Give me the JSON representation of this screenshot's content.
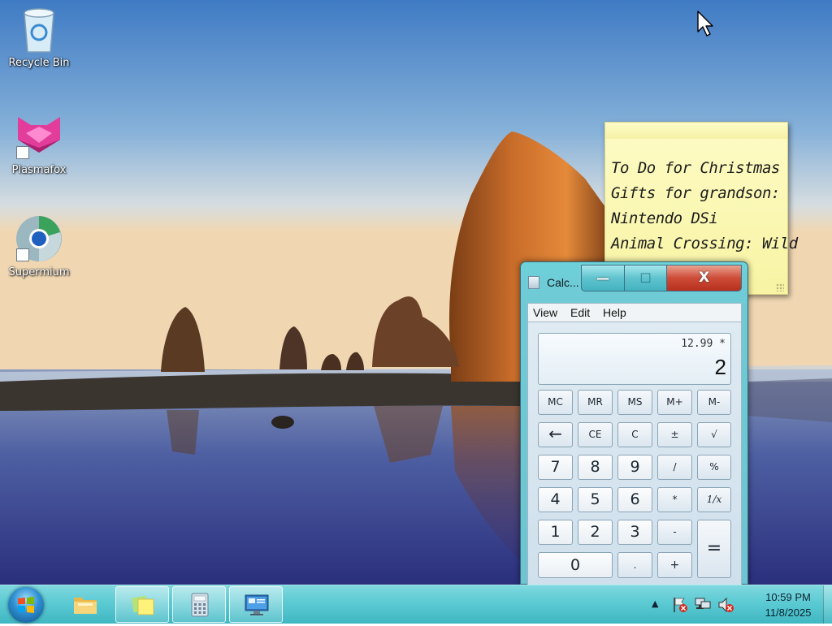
{
  "desktop": {
    "icons": [
      {
        "label": "Recycle Bin",
        "icon": "recycle-bin-icon"
      },
      {
        "label": "Plasmafox",
        "icon": "plasmafox-icon"
      },
      {
        "label": "Supermium",
        "icon": "supermium-icon"
      }
    ]
  },
  "sticky_note": {
    "lines": [
      "To Do for Christmas",
      "Gifts for grandson:",
      "Nintendo DSi",
      "Animal Crossing: Wild"
    ]
  },
  "calculator": {
    "title": "Calc...",
    "menu": [
      "View",
      "Edit",
      "Help"
    ],
    "expression": "12.99 *",
    "value": "2",
    "keys": {
      "mc": "MC",
      "mr": "MR",
      "ms": "MS",
      "mplus": "M+",
      "mminus": "M-",
      "back": "←",
      "ce": "CE",
      "c": "C",
      "plusminus": "±",
      "sqrt": "√",
      "k7": "7",
      "k8": "8",
      "k9": "9",
      "div": "/",
      "pct": "%",
      "k4": "4",
      "k5": "5",
      "k6": "6",
      "mul": "*",
      "recip": "1/x",
      "k1": "1",
      "k2": "2",
      "k3": "3",
      "sub": "-",
      "eq": "=",
      "k0": "0",
      "dot": ".",
      "add": "+"
    },
    "caption": {
      "minimize": "—",
      "maximize": "☐",
      "close": "X"
    }
  },
  "taskbar": {
    "items": [
      {
        "name": "windows-explorer",
        "icon": "folder-icon"
      },
      {
        "name": "sticky-notes",
        "icon": "sticky-notes-icon"
      },
      {
        "name": "calculator",
        "icon": "calculator-icon"
      },
      {
        "name": "remote-desktop",
        "icon": "remote-desktop-icon"
      }
    ],
    "tray": {
      "time": "10:59 PM",
      "date": "11/8/2025",
      "overflow": "▲"
    }
  },
  "colors": {
    "taskbar": "#5ccad3",
    "calc_frame": "#6ecbd6",
    "close_button": "#cd4c38",
    "sticky_note": "#f8f4a4"
  }
}
